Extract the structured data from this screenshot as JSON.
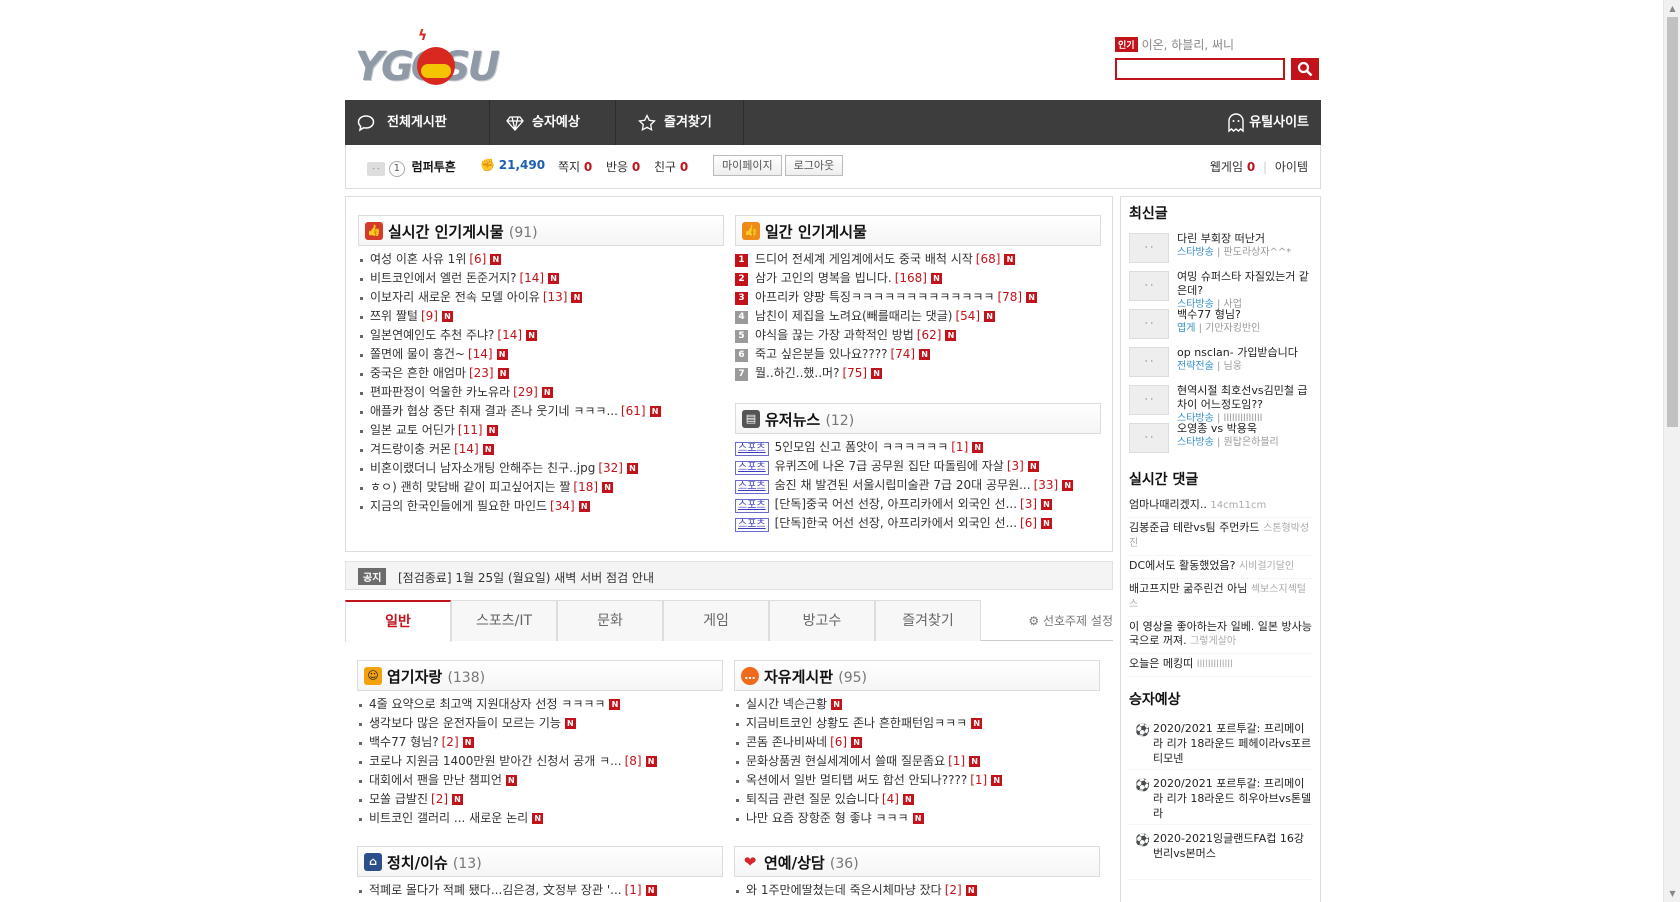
{
  "logo": {
    "text": "YGOSU"
  },
  "search": {
    "hot_label": "인기",
    "hot_terms": "이온, 하블리, 써니",
    "placeholder": ""
  },
  "nav": {
    "items": [
      "전체게시판",
      "승자예상",
      "즐겨찾기"
    ],
    "right": "유틸사이트"
  },
  "user": {
    "level": "1",
    "name": "럼퍼투흔",
    "points": "21,490",
    "msg_label": "쪽지",
    "msg": "0",
    "react_label": "반응",
    "react": "0",
    "friend_label": "친구",
    "friend": "0",
    "mypage": "마이페이지",
    "logout": "로그아웃",
    "webgame_label": "웹게임",
    "webgame": "0",
    "item_label": "아이템"
  },
  "realtime": {
    "title": "실시간 인기게시물",
    "count": "(91)",
    "items": [
      {
        "t": "여성 이혼 사유 1위",
        "c": "[6]"
      },
      {
        "t": "비트코인에서 엘런 돈준거지?",
        "c": "[14]"
      },
      {
        "t": "이보자리 새로운 전속 모델 아이유",
        "c": "[13]"
      },
      {
        "t": "쯔위 짤털",
        "c": "[9]"
      },
      {
        "t": "일본연예인도 추천 주냐?",
        "c": "[14]"
      },
      {
        "t": "쫄면에 물이 흥건~",
        "c": "[14]"
      },
      {
        "t": "중국은 흔한 애엄마",
        "c": "[23]"
      },
      {
        "t": "편파판정이 억울한 카노유라",
        "c": "[29]"
      },
      {
        "t": "애플카 협상 중단 취재 결과 존나 웃기네 ㅋㅋㅋ...",
        "c": "[61]"
      },
      {
        "t": "일본 교토 어딘가",
        "c": "[11]"
      },
      {
        "t": "겨드랑이충 커몬",
        "c": "[14]"
      },
      {
        "t": "비혼이랬더니 남자소개팅 안해주는 친구..jpg",
        "c": "[32]"
      },
      {
        "t": "ㅎㅇ) 괜히 맞담배 같이 피고싶어지는 짤",
        "c": "[18]"
      },
      {
        "t": "지금의 한국인들에게 필요한 마인드",
        "c": "[34]"
      }
    ]
  },
  "daily": {
    "title": "일간 인기게시물",
    "items": [
      {
        "rank": "1",
        "t": "드디어 전세계 게임계에서도 중국 배척 시작",
        "c": "[68]"
      },
      {
        "rank": "2",
        "t": "삼가 고인의 명복을 빕니다.",
        "c": "[168]"
      },
      {
        "rank": "3",
        "t": "아프리카 양팡 특징ㅋㅋㅋㅋㅋㅋㅋㅋㅋㅋㅋㅋㅋ",
        "c": "[78]"
      },
      {
        "rank": "4",
        "t": "남친이 제집을 노려요(빼를때리는 댓글)",
        "c": "[54]"
      },
      {
        "rank": "5",
        "t": "야식을 끊는 가장 과학적인 방법",
        "c": "[62]"
      },
      {
        "rank": "6",
        "t": "죽고 싶은분들 있나요????",
        "c": "[74]"
      },
      {
        "rank": "7",
        "t": "뭘..하긴..했..머?",
        "c": "[75]"
      }
    ]
  },
  "usernews": {
    "title": "유저뉴스",
    "count": "(12)",
    "tag": "스포츠",
    "items": [
      {
        "t": "5인모임 신고 폼앗이 ㅋㅋㅋㅋㅋㅋ",
        "c": "[1]"
      },
      {
        "t": "유퀴즈에 나온 7급 공무원 집단 따돌림에 자살",
        "c": "[3]"
      },
      {
        "t": "숨진 채 발견된 서울시립미술관 7급 20대 공무원...",
        "c": "[33]"
      },
      {
        "t": "[단독]중국 어선 선장, 아프리카에서 외국인 선...",
        "c": "[3]"
      },
      {
        "t": "[단독]한국 어선 선장, 아프리카에서 외국인 선...",
        "c": "[6]"
      }
    ]
  },
  "notice": {
    "badge": "공지",
    "text": "[점검종료] 1월 25일 (월요일) 새벽 서버 점검 안내"
  },
  "tabs": {
    "items": [
      "일반",
      "스포츠/IT",
      "문화",
      "게임",
      "방고수",
      "즐겨찾기"
    ],
    "setting": "선호주제 설정"
  },
  "humor": {
    "title": "엽기자랑",
    "count": "(138)",
    "items": [
      {
        "t": "4줄 요약으로 최고액 지원대상자 선정 ㅋㅋㅋㅋ",
        "c": ""
      },
      {
        "t": "생각보다 많은 운전자들이 모르는 기능",
        "c": ""
      },
      {
        "t": "백수77 형님?",
        "c": "[2]"
      },
      {
        "t": "코로나 지원금 1400만원 받아간 신청서 공개 ㅋ...",
        "c": "[8]"
      },
      {
        "t": "대회에서 팬을 만난 챔피언",
        "c": ""
      },
      {
        "t": "모쏠 급발진",
        "c": "[2]"
      },
      {
        "t": "비트코인 갤러리 ... 새로운 논리",
        "c": ""
      }
    ]
  },
  "free": {
    "title": "자유게시판",
    "count": "(95)",
    "items": [
      {
        "t": "실시간 넥슨근황",
        "c": ""
      },
      {
        "t": "지금비트코인 상황도 존나 흔한패턴임ㅋㅋㅋ",
        "c": ""
      },
      {
        "t": "콘돔 존나비싸네",
        "c": "[6]"
      },
      {
        "t": "문화상품권 현실세계에서 쓸때 질문좀요",
        "c": "[1]"
      },
      {
        "t": "옥션에서 일반 멀티탭 써도 합선 안되나????",
        "c": "[1]"
      },
      {
        "t": "퇴직금 관련 질문 있습니다",
        "c": "[4]"
      },
      {
        "t": "나만 요즘 장항준 형 좋냐 ㅋㅋㅋ",
        "c": ""
      }
    ]
  },
  "politics": {
    "title": "정치/이슈",
    "count": "(13)",
    "items": [
      {
        "t": "적폐로 몰다가 적폐 됐다...김은경, 文정부 장관 '...",
        "c": "[1]"
      }
    ]
  },
  "love": {
    "title": "연예/상담",
    "count": "(36)",
    "items": [
      {
        "t": "와 1주만에딸쳤는데 죽은시체마냥 잤다",
        "c": "[2]"
      }
    ]
  },
  "sidebar": {
    "latest_title": "최신글",
    "latest": [
      {
        "t": "다린 부회장 떠난거",
        "cat": "스타방송",
        "who": "판도라상자^^*"
      },
      {
        "t": "여밍 슈퍼스타 자질있는거 같은데?",
        "cat": "스타방송",
        "who": "사업"
      },
      {
        "t": "백수77 형님?",
        "cat": "엽게",
        "who": "기만자킹반인"
      },
      {
        "t": "op nsclan- 가입받습니다",
        "cat": "전략전술",
        "who": "님웅"
      },
      {
        "t": "현역시절 최호선vs김민철 급차이 어느정도임??",
        "cat": "스타방송",
        "who": "llllllllllllll"
      },
      {
        "t": "오영종 vs 박용욱",
        "cat": "스타방송",
        "who": "원탑은하블리"
      }
    ],
    "comments_title": "실시간 댓글",
    "comments": [
      {
        "t": "엄마나때리겠지..",
        "who": "14cm11cm"
      },
      {
        "t": "김봉준급 테란vs팀 주먼카드",
        "who": "스톤형박성진"
      },
      {
        "t": "DC에서도 활동했었음?",
        "who": "시비걸기달인"
      },
      {
        "t": "배고프지만 굶주린건 아님",
        "who": "섹보스지섹털스"
      },
      {
        "t": "이 영상을 좋아하는자 일베. 일본 방사능국으로 꺼져.",
        "who": "그렇게살아"
      },
      {
        "t": "오늘은 메킹띠",
        "who": "lllllllllllll"
      }
    ],
    "predict_title": "승자예상",
    "predict": [
      {
        "t": "2020/2021 포르투갈: 프리메이라 리가 18라운드 페헤이라vs포르티모넨"
      },
      {
        "t": "2020/2021 포르투갈: 프리메이라 리가 18라운드 히우아브vs톤델라"
      },
      {
        "t": "2020-2021잉글랜드FA컵 16강 번리vs본머스"
      }
    ]
  }
}
